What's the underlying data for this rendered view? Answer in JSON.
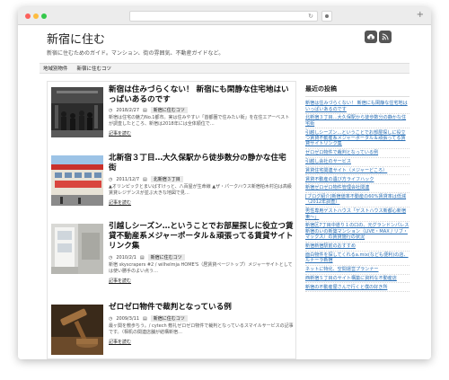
{
  "site": {
    "title": "新宿に住む",
    "description": "新宿に住むためのガイド。マンション、街の雰囲気、不動産ガイドなど。"
  },
  "nav": {
    "items": [
      "地域別物件",
      "新宿に住むコツ"
    ]
  },
  "posts": [
    {
      "title": "新宿は住みづらくない！ 新宿にも閑静な住宅地はいっぱいあるのです",
      "date": "2018/2/27",
      "category": "新宿に住むコツ",
      "excerpt": "新宿は住宅の魅力No.1都市。実は住みやすい「首都圏で住みたい街」を在住エアーベストが調査したところ、新宿は2018年には全体順位で…",
      "more": "記事を読む"
    },
    {
      "title": "北新宿３丁目…大久保駅から徒歩数分の静かな住宅街",
      "date": "2011/12/7",
      "category": "北新宿３丁目",
      "excerpt": "▲オリンピックとまいばすけっと、八百屋が生命線 ▲ザ・パークハウス新宿柏木村泊は高級賃貸レジデンスが並ぶ大きな地図で見…",
      "more": "記事を読む"
    },
    {
      "title": "引越しシーズン…ということでお部屋探しに役立つ賃貸不動産系メジャーポータル＆頑張ってる賃貸サイトリンク集",
      "date": "2010/2/1",
      "category": "新宿に住むコツ",
      "excerpt": "新宿 skyscrapers #2 / wilhelmja HOME'S（居賃貸ページトップ）メジャーサイトとしては使い勝手のよい点う…",
      "more": "記事を読む"
    },
    {
      "title": "ゼロゼロ物件で裁判となっている例",
      "date": "2009/3/11",
      "category": "新宿に住むコツ",
      "excerpt": "最ヶ関を敷歩ちう。/ cytech 敷礼ゼロゼロ物件で裁判となっているスマイルサービスの記事です。（相机の関連店舗が結構新宿…",
      "more": "記事を読む"
    }
  ],
  "sidebar": {
    "heading": "最近の投稿",
    "links": [
      "新宿は住みづらくない！ 新宿にも閑静な住宅地はいっぱいあるのです",
      "北新宿３丁目…大久保駅から徒歩数分の静かな住宅街",
      "引越しシーズン…ということでお部屋探しに役立つ賃貸不動産系メジャーポータル＆頑張ってる賃貸サイトリンク集",
      "ゼロゼロ物件で裁判となっている例",
      "引越し会社のサービス",
      "賃貸住宅関連サイト（メジャーどころ）",
      "賃貸不動産の遺び方ライフハック",
      "新宿ゼロゼロ物件管理会社関連",
      "[ブログ紹介]新宿値率不動産の60%賃貸率は低減（2012年調査）",
      "男性専用ゲストハウス「ゲストハウス新都心新宿東～」",
      "新宿区7丁目中道り１の口の、元グランドンパレス新宿のいの新築マンション（LIVE・MAX / リブ・マックス）の賃貸施行の状況",
      "新宿新宿駅前のおすすめ",
      "面白物件を探してくれるa.mix(なども便利)の店、ルナーラ新宿",
      "ネットに特化、空間運営プランナー",
      "西新宿５丁目のサイト構築に資料な不動産店",
      "新宿の不動産屋さんで行くと僕の好き所"
    ]
  },
  "icons": {
    "header": [
      "cloud-download-icon",
      "rss-icon"
    ]
  }
}
